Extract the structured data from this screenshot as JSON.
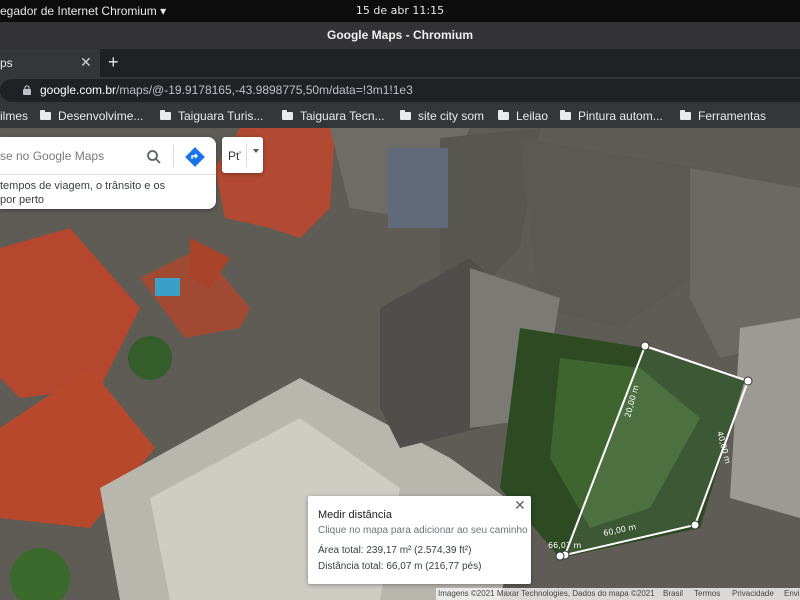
{
  "os": {
    "app_name": "egador de Internet Chromium ▾",
    "clock": "15 de abr  11:15"
  },
  "window": {
    "title": "Google Maps - Chromium"
  },
  "tabs": {
    "active_title": "ps",
    "close": "✕",
    "new_tab": "+"
  },
  "omnibox": {
    "host": "google.com.br",
    "path": "/maps/@-19.9178165,-43.9898775,50m/data=!3m1!1e3"
  },
  "bookmarks": [
    {
      "label": "ilmes",
      "folder": false
    },
    {
      "label": "Desenvolvime...",
      "folder": true
    },
    {
      "label": "Taiguara Turis...",
      "folder": true
    },
    {
      "label": "Taiguara Tecn...",
      "folder": true
    },
    {
      "label": "site city som",
      "folder": true
    },
    {
      "label": "Leilao",
      "folder": true
    },
    {
      "label": "Pintura autom...",
      "folder": true
    },
    {
      "label": "Ferramentas",
      "folder": true
    }
  ],
  "search": {
    "placeholder": "se no Google Maps",
    "hint_line1": "tempos de viagem, o trânsito e os",
    "hint_line2": "por perto"
  },
  "layers": {
    "label": "Pť"
  },
  "measure": {
    "title": "Medir distância",
    "hint": "Clique no mapa para adicionar ao seu caminho",
    "area": "Área total: 239,17 m² (2.574,39 ft²)",
    "distance": "Distância total: 66,07 m (216,77 pés)",
    "close": "✕"
  },
  "map_labels": {
    "seg1": "20,00 m",
    "seg2": "40,00 m",
    "seg3": "60,00 m",
    "seg4": "66,07 m"
  },
  "footer": {
    "imagery": "Imagens ©2021 Maxar Technologies, Dados do mapa ©2021",
    "country": "Brasil",
    "terms": "Termos",
    "privacy": "Privacidade",
    "feedback": "Envi"
  },
  "colors": {
    "measure_line": "#ffffff",
    "directions_blue": "#1a73e8"
  }
}
